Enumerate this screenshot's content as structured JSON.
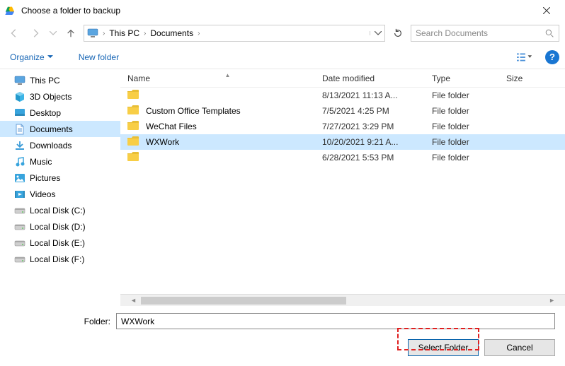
{
  "window": {
    "title": "Choose a folder to backup"
  },
  "nav": {
    "breadcrumbs": [
      "This PC",
      "Documents"
    ]
  },
  "search": {
    "placeholder": "Search Documents"
  },
  "toolbar": {
    "organize": "Organize",
    "newfolder": "New folder"
  },
  "sidebar": {
    "items": [
      {
        "label": "This PC",
        "icon": "pc"
      },
      {
        "label": "3D Objects",
        "icon": "3d"
      },
      {
        "label": "Desktop",
        "icon": "desktop"
      },
      {
        "label": "Documents",
        "icon": "documents",
        "selected": true
      },
      {
        "label": "Downloads",
        "icon": "downloads"
      },
      {
        "label": "Music",
        "icon": "music"
      },
      {
        "label": "Pictures",
        "icon": "pictures"
      },
      {
        "label": "Videos",
        "icon": "videos"
      },
      {
        "label": "Local Disk (C:)",
        "icon": "disk"
      },
      {
        "label": "Local Disk (D:)",
        "icon": "disk"
      },
      {
        "label": "Local Disk (E:)",
        "icon": "disk"
      },
      {
        "label": "Local Disk (F:)",
        "icon": "disk"
      }
    ]
  },
  "columns": {
    "name": "Name",
    "date": "Date modified",
    "type": "Type",
    "size": "Size"
  },
  "rows": [
    {
      "name": "",
      "date": "8/13/2021 11:13 A...",
      "type": "File folder"
    },
    {
      "name": "Custom Office Templates",
      "date": "7/5/2021 4:25 PM",
      "type": "File folder"
    },
    {
      "name": "WeChat Files",
      "date": "7/27/2021 3:29 PM",
      "type": "File folder"
    },
    {
      "name": "WXWork",
      "date": "10/20/2021 9:21 A...",
      "type": "File folder",
      "selected": true
    },
    {
      "name": "",
      "date": "6/28/2021 5:53 PM",
      "type": "File folder"
    }
  ],
  "folderField": {
    "label": "Folder:",
    "value": "WXWork"
  },
  "buttons": {
    "select": "Select Folder",
    "cancel": "Cancel"
  }
}
